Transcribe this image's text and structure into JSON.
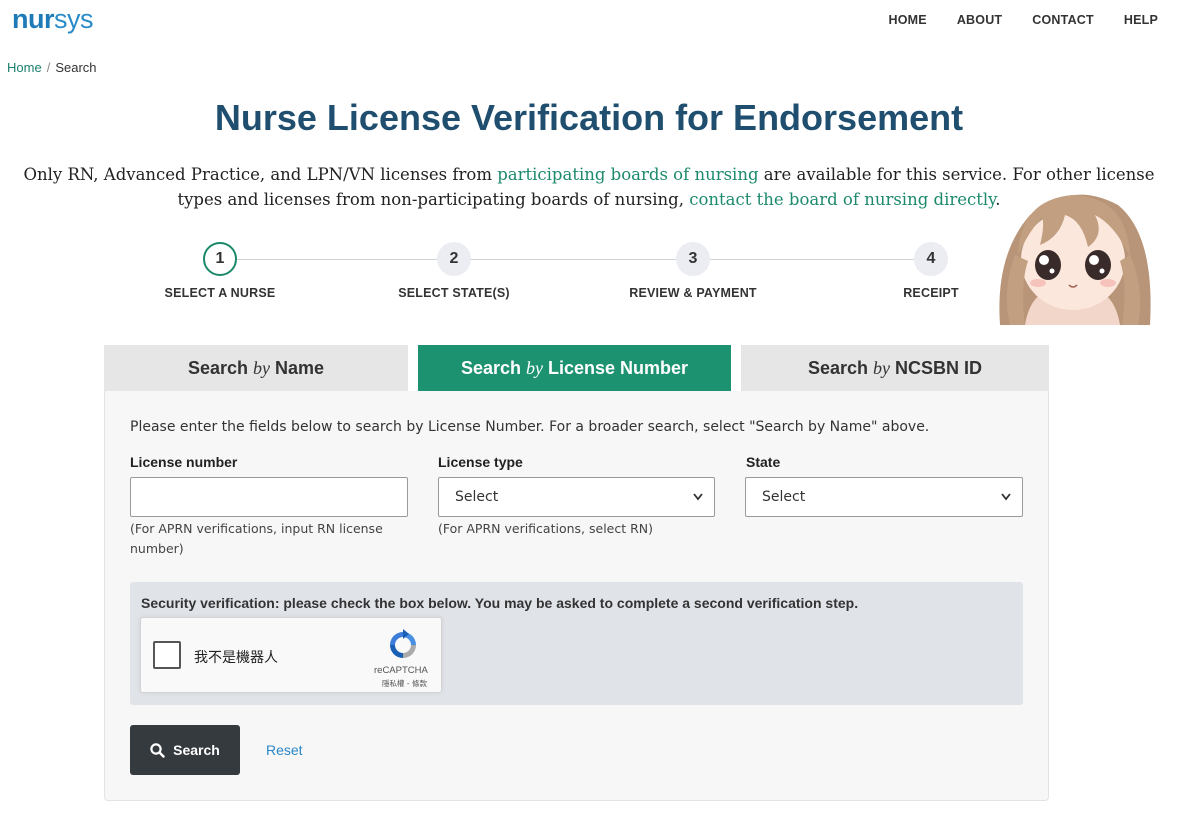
{
  "header": {
    "logo_bold": "nur",
    "logo_light": "sys",
    "nav": [
      {
        "label": "HOME"
      },
      {
        "label": "ABOUT"
      },
      {
        "label": "CONTACT"
      },
      {
        "label": "HELP"
      }
    ]
  },
  "breadcrumb": {
    "home": "Home",
    "separator": "/",
    "current": "Search"
  },
  "page_title": "Nurse License Verification for Endorsement",
  "intro": {
    "text1": "Only RN, Advanced Practice, and LPN/VN licenses from ",
    "link1": "participating boards of nursing",
    "text2": " are available for this service. For other license types and licenses from non-participating boards of nursing, ",
    "link2": "contact the board of nursing directly",
    "text3": "."
  },
  "steps": [
    {
      "number": "1",
      "label": "SELECT A NURSE",
      "active": true
    },
    {
      "number": "2",
      "label": "SELECT STATE(S)",
      "active": false
    },
    {
      "number": "3",
      "label": "REVIEW & PAYMENT",
      "active": false
    },
    {
      "number": "4",
      "label": "RECEIPT",
      "active": false
    }
  ],
  "tabs": [
    {
      "pre": "Search ",
      "by": "by",
      "post": " Name",
      "active": false
    },
    {
      "pre": "Search ",
      "by": "by",
      "post": " License Number",
      "active": true
    },
    {
      "pre": "Search ",
      "by": "by",
      "post": " NCSBN ID",
      "active": false
    }
  ],
  "form": {
    "instructions": "Please enter the fields below to search by License Number. For a broader search, select \"Search by Name\" above.",
    "license_number": {
      "label": "License number",
      "value": "",
      "hint": "(For APRN verifications, input RN license number)"
    },
    "license_type": {
      "label": "License type",
      "selected": "Select",
      "hint": "(For APRN verifications, select RN)"
    },
    "state": {
      "label": "State",
      "selected": "Select"
    }
  },
  "security": {
    "text": "Security verification: please check the box below. You may be asked to complete a second verification step.",
    "recaptcha_label": "我不是機器人",
    "recaptcha_brand": "reCAPTCHA",
    "recaptcha_terms": "隱私權 - 條款"
  },
  "actions": {
    "search_label": "Search",
    "reset_label": "Reset"
  },
  "colors": {
    "brand_blue": "#1e7bb8",
    "title_navy": "#1f4e6e",
    "accent_green": "#1d9270",
    "button_dark": "#353a3f",
    "link_blue": "#2b87c6"
  }
}
